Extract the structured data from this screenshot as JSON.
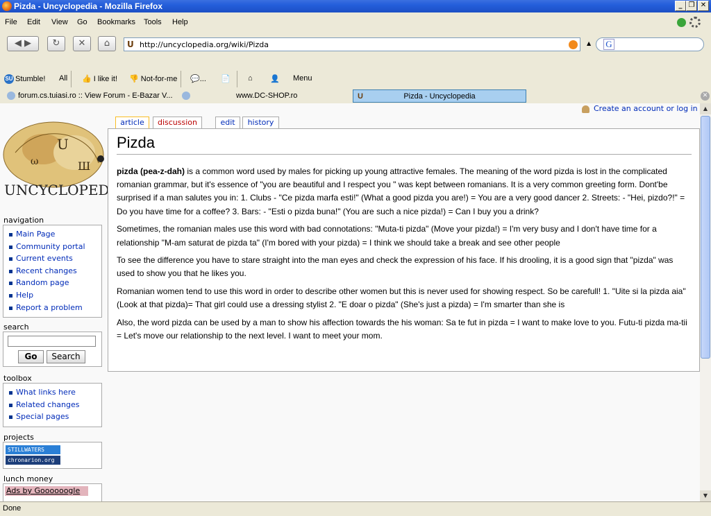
{
  "window": {
    "title": "Pizda - Uncyclopedia - Mozilla Firefox"
  },
  "menu": [
    "File",
    "Edit",
    "View",
    "Go",
    "Bookmarks",
    "Tools",
    "Help"
  ],
  "address": {
    "url": "http://uncyclopedia.org/wiki/Pizda"
  },
  "stumble": {
    "stumble_label": "Stumble!",
    "all_label": "All",
    "like_label": "I like it!",
    "notfor_label": "Not-for-me",
    "comment_label": "...",
    "menu_label": "Menu"
  },
  "tabs": [
    {
      "label": "forum.cs.tuiasi.ro :: View Forum - E-Bazar V..."
    },
    {
      "label": "www.DC-SHOP.ro"
    },
    {
      "label": "Pizda - Uncyclopedia"
    }
  ],
  "sidebar": {
    "logo_text": "UNCYCLOPEDIA",
    "navigation_title": "navigation",
    "navigation": [
      "Main Page",
      "Community portal",
      "Current events",
      "Recent changes",
      "Random page",
      "Help",
      "Report a problem"
    ],
    "search_title": "search",
    "go_label": "Go",
    "search_label": "Search",
    "toolbox_title": "toolbox",
    "toolbox": [
      "What links here",
      "Related changes",
      "Special pages"
    ],
    "projects_title": "projects",
    "projects_badge1": "STILLWATERS",
    "projects_badge2": "chronarion.org",
    "lunch_title": "lunch money",
    "ads_label": "Ads by Goooooogle"
  },
  "page": {
    "user_link": "Create an account or log in",
    "tab_article": "article",
    "tab_discussion": "discussion",
    "tab_edit": "edit",
    "tab_history": "history",
    "heading": "Pizda",
    "p1_bold": "pizda (pea-z-dah)",
    "p1_rest": " is a common word used by males for picking up young attractive females. The meaning of the word pizda is lost in the complicated romanian grammar, but it's essence of \"you are beautiful and I respect you \" was kept between romanians. It is a very common greeting form. Dont'be surprised if a man salutes you in: 1. Clubs - \"Ce pizda marfa esti!\" (What a good pizda you are!) = You are a very good dancer 2. Streets: - \"Hei, pizdo?!\" = Do you have time for a coffee? 3. Bars: - \"Esti o pizda buna!\" (You are such a nice pizda!) = Can I buy you a drink?",
    "p2": "Sometimes, the romanian males use this word with bad connotations: \"Muta-ti pizda\" (Move your pizda!) = I'm very busy and I don't have time for a relationship \"M-am saturat de pizda ta\" (I'm bored with your pizda) = I think we should take a break and see other people",
    "p3": "To see the difference you have to stare straight into the man eyes and check the expression of his face. If his drooling, it is a good sign that \"pizda\" was used to show you that he likes you.",
    "p4": "Romanian women tend to use this word in order to describe other women but this is never used for showing respect. So be carefull! 1. \"Uite si la pizda aia\" (Look at that pizda)= That girl could use a dressing stylist 2. \"E doar o pizda\" (She's just a pizda) = I'm smarter than she is",
    "p5": "Also, the word pizda can be used by a man to show his affection towards the his woman: Sa te fut in pizda = I want to make love to you. Futu-ti pizda ma-tii = Let's move our relationship to the next level. I want to meet your mom."
  },
  "status": {
    "text": "Done"
  }
}
